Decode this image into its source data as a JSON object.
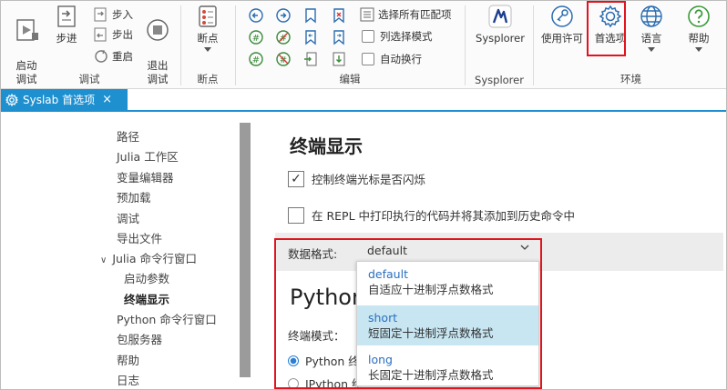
{
  "ribbon": {
    "groups": {
      "debug": "调试",
      "breakpoints": "断点",
      "edit": "编辑",
      "sysplorer": "Sysplorer",
      "environment": "环境"
    },
    "debug": {
      "start": "启动\n调试",
      "step": "步进",
      "step_in": "步入",
      "step_out": "步出",
      "restart": "重启",
      "exit": "退出\n调试"
    },
    "breakpoints": {
      "label": "断点"
    },
    "edit": {
      "select_all_matches": "选择所有匹配项",
      "column_select": "列选择模式",
      "word_wrap": "自动换行"
    },
    "sysplorer": {
      "label": "Sysplorer"
    },
    "environment": {
      "license": "使用许可",
      "preferences": "首选项",
      "language": "语言",
      "help": "帮助"
    }
  },
  "tab": {
    "label": "Syslab 首选项",
    "close": "×"
  },
  "nav": {
    "items": [
      "路径",
      "Julia 工作区",
      "变量编辑器",
      "预加载",
      "调试",
      "导出文件",
      "Julia 命令行窗口",
      "启动参数",
      "终端显示",
      "Python 命令行窗口",
      "包服务器",
      "帮助",
      "日志"
    ],
    "expander": "∨"
  },
  "content": {
    "terminal_heading": "终端显示",
    "cursor_blink": "控制终端光标是否闪烁",
    "repl_print": "在 REPL 中打印执行的代码并将其添加到历史命令中",
    "format_label": "数据格式:",
    "format_value": "default",
    "python_heading": "Python",
    "terminal_mode": "终端模式：",
    "radio_python": "Python 终",
    "radio_ipython": "IPython 终"
  },
  "dropdown": [
    {
      "name": "default",
      "desc": "自适应十进制浮点数格式"
    },
    {
      "name": "short",
      "desc": "短固定十进制浮点数格式"
    },
    {
      "name": "long",
      "desc": "长固定十进制浮点数格式"
    }
  ],
  "colors": {
    "accent": "#1e90d0",
    "highlight": "#e0141e",
    "selected": "#c7e6f2"
  }
}
